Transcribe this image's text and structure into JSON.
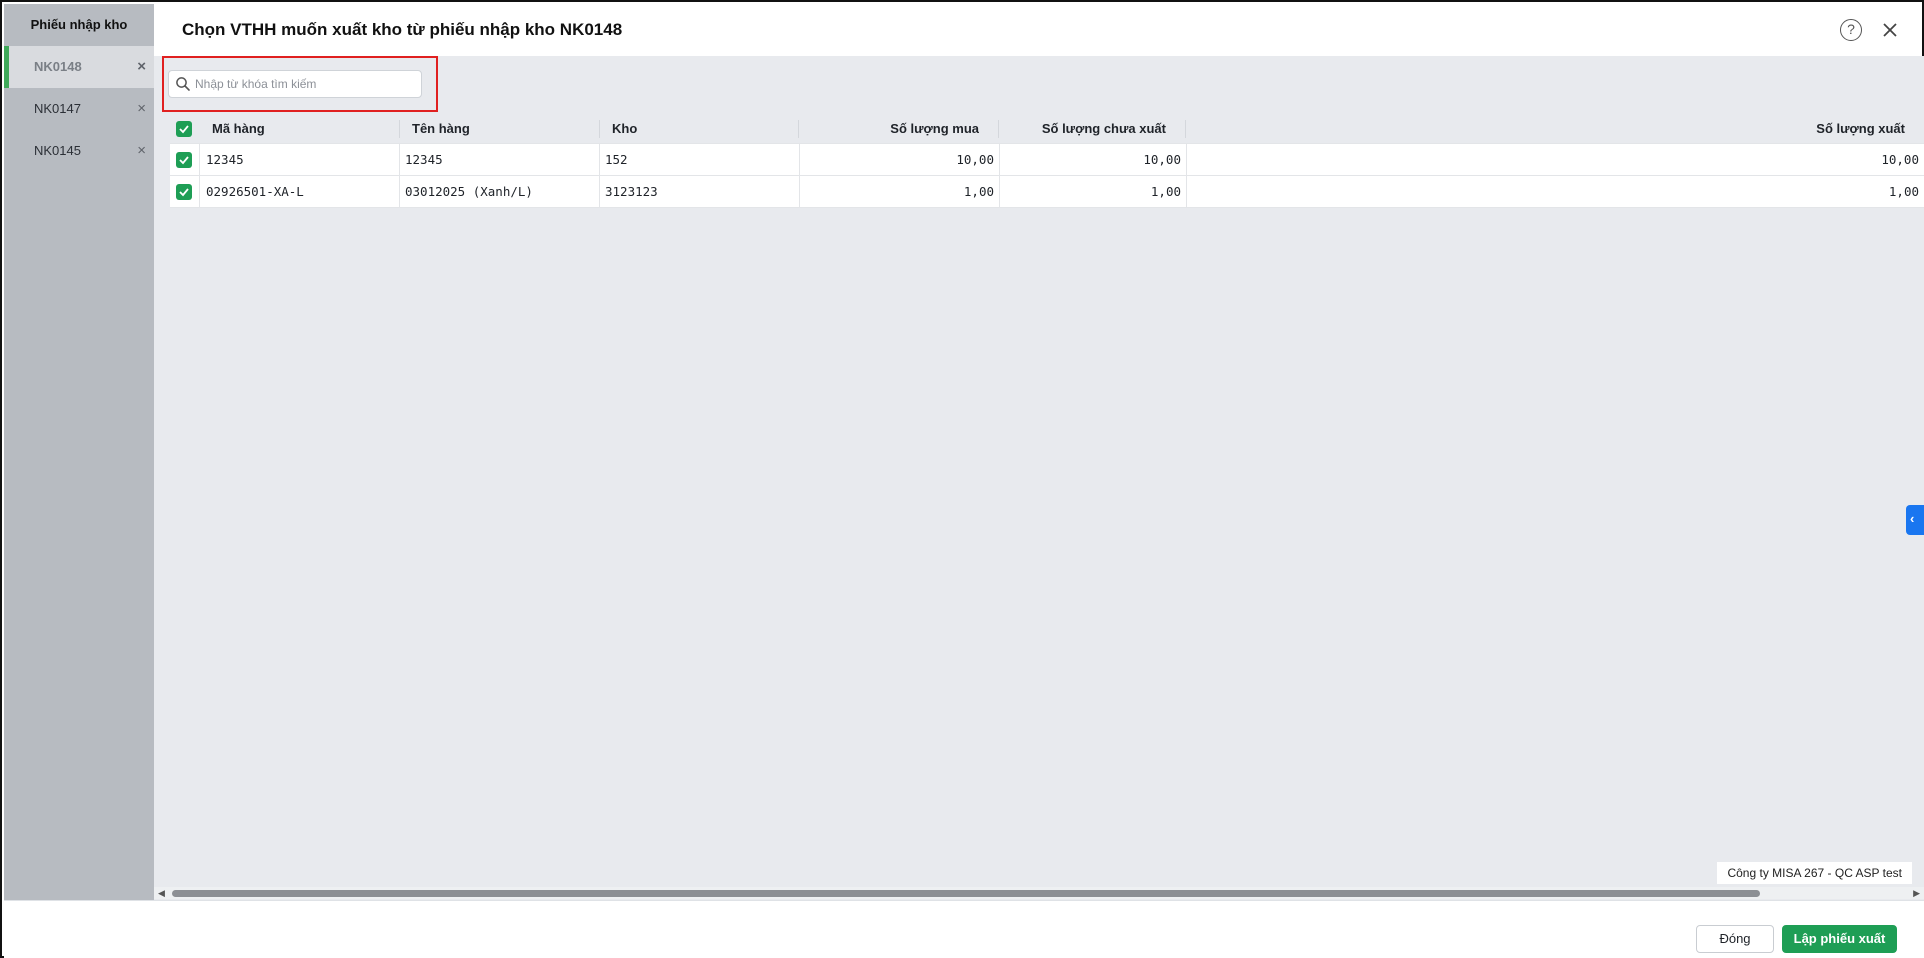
{
  "sidebar": {
    "title": "Phiếu nhập kho",
    "items": [
      {
        "label": "NK0148",
        "active": true
      },
      {
        "label": "NK0147",
        "active": false
      },
      {
        "label": "NK0145",
        "active": false
      }
    ],
    "close_glyph": "×"
  },
  "header": {
    "title": "Chọn VTHH muốn xuất kho từ phiếu nhập kho NK0148",
    "help_glyph": "?",
    "icons": [
      "help-icon",
      "close-icon"
    ]
  },
  "search": {
    "placeholder": "Nhập từ khóa tìm kiếm",
    "value": ""
  },
  "table": {
    "columns": [
      "Mã hàng",
      "Tên hàng",
      "Kho",
      "Số lượng mua",
      "Số lượng chưa xuất",
      "Số lượng xuất"
    ],
    "rows": [
      {
        "ma_hang": "12345",
        "ten_hang": "12345",
        "kho": "152",
        "sl_mua": "10,00",
        "sl_chua_xuat": "10,00",
        "sl_xuat": "10,00",
        "checked": true
      },
      {
        "ma_hang": "02926501-XA-L",
        "ten_hang": "03012025 (Xanh/L)",
        "kho": "3123123",
        "sl_mua": "1,00",
        "sl_chua_xuat": "1,00",
        "sl_xuat": "1,00",
        "checked": true
      }
    ]
  },
  "side_tab_glyph": "‹",
  "company": "Công ty MISA 267 - QC ASP test",
  "scroll": {
    "left_glyph": "◀",
    "right_glyph": "▶"
  },
  "footer": {
    "close_label": "Đóng",
    "primary_label": "Lập phiếu xuất"
  },
  "colors": {
    "accent_green": "#1e9e55",
    "active_bar": "#3fa95a",
    "side_tab_blue": "#1976f0",
    "highlight_red": "#e02020"
  }
}
